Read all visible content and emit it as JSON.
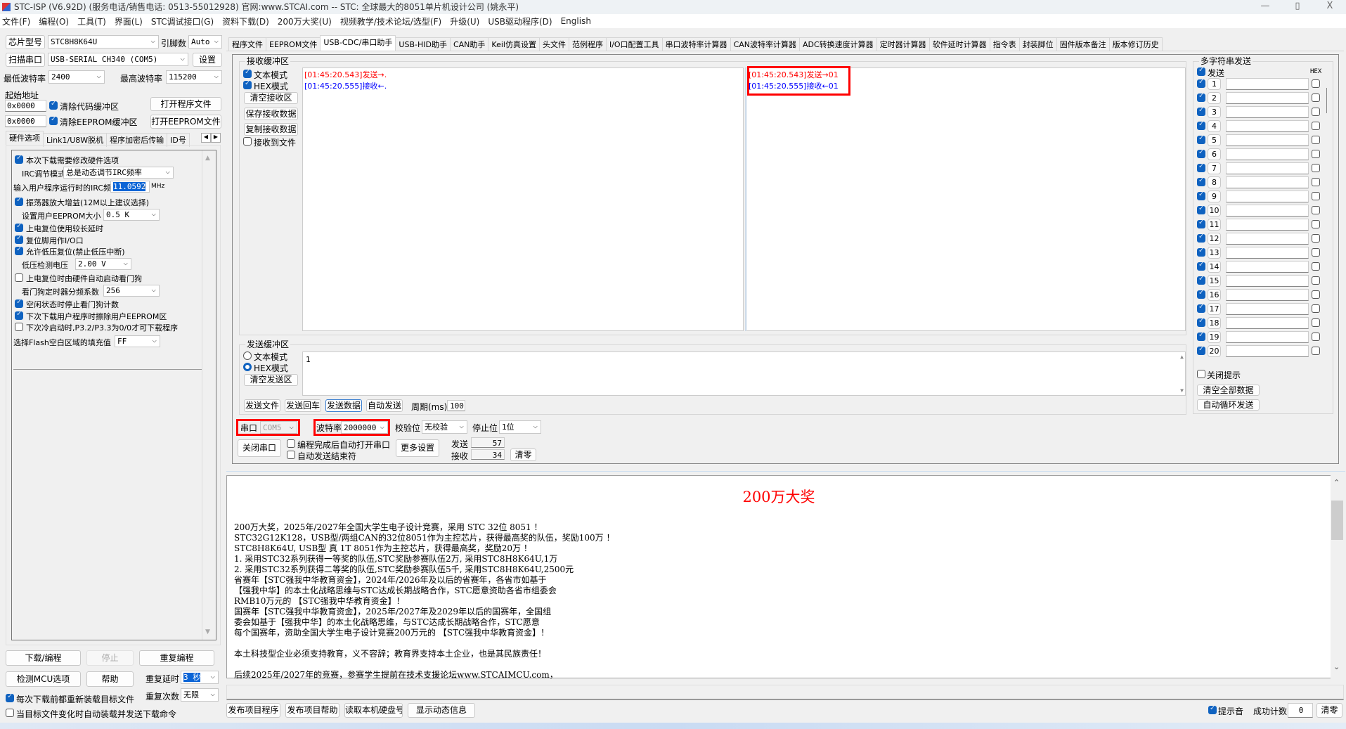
{
  "window": {
    "title": "STC-ISP (V6.92D) (服务电话/销售电话: 0513-55012928) 官网:www.STCAI.com  -- STC: 全球最大的8051单片机设计公司 (姚永平)",
    "minimize": "—",
    "maximize": "▯",
    "close": "X"
  },
  "menu": [
    "文件(F)",
    "编程(O)",
    "工具(T)",
    "界面(L)",
    "STC调试接口(G)",
    "资料下载(D)",
    "200万大奖(U)",
    "视频教学/技术论坛/选型(F)",
    "升级(U)",
    "USB驱动程序(D)",
    "English"
  ],
  "left": {
    "chip_label": "芯片型号",
    "chip_value": "STC8H8K64U",
    "pins_label": "引脚数",
    "pins_value": "Auto",
    "scan_label": "扫描串口",
    "port_value": "USB-SERIAL CH340 (COM5)",
    "settings_label": "设置",
    "min_baud_label": "最低波特率",
    "min_baud": "2400",
    "max_baud_label": "最高波特率",
    "max_baud": "115200",
    "start_addr_label": "起始地址",
    "code_addr": "0x0000",
    "clear_code": "清除代码缓冲区",
    "clear_code_checked": true,
    "eeprom_addr": "0x0000",
    "clear_eeprom": "清除EEPROM缓冲区",
    "clear_eeprom_checked": true,
    "open_prog": "打开程序文件",
    "open_eeprom": "打开EEPROM文件",
    "tabs": [
      "硬件选项",
      "Link1/U8W脱机",
      "程序加密后传输",
      "ID号"
    ],
    "options": [
      {
        "type": "check",
        "checked": true,
        "label": "本次下载需要修改硬件选项"
      },
      {
        "type": "select",
        "label": "IRC调节模式",
        "value": "总是动态调节IRC频率"
      },
      {
        "type": "select",
        "label": "输入用户程序运行时的IRC频率",
        "value": "11.0592",
        "unit": "MHz"
      },
      {
        "type": "check",
        "checked": true,
        "label": "振荡器放大增益(12M以上建议选择)"
      },
      {
        "type": "select",
        "label": "设置用户EEPROM大小",
        "value": "0.5 K"
      },
      {
        "type": "check",
        "checked": true,
        "label": "上电复位使用较长延时"
      },
      {
        "type": "check",
        "checked": true,
        "label": "复位脚用作I/O口"
      },
      {
        "type": "check",
        "checked": true,
        "label": "允许低压复位(禁止低压中断)"
      },
      {
        "type": "select",
        "label": "低压检测电压",
        "value": "2.00 V"
      },
      {
        "type": "check",
        "checked": false,
        "label": "上电复位时由硬件自动启动看门狗"
      },
      {
        "type": "select",
        "label": "看门狗定时器分频系数",
        "value": "256"
      },
      {
        "type": "check",
        "checked": true,
        "label": "空闲状态时停止看门狗计数"
      },
      {
        "type": "check",
        "checked": true,
        "label": "下次下载用户程序时擦除用户EEPROM区"
      },
      {
        "type": "check",
        "checked": false,
        "label": "下次冷启动时,P3.2/P3.3为0/0才可下载程序"
      },
      {
        "type": "select",
        "label": "选择Flash空白区域的填充值",
        "value": "FF"
      }
    ],
    "download": "下载/编程",
    "stop": "停止",
    "repeat_prog": "重复编程",
    "detect": "检测MCU选项",
    "help": "帮助",
    "repeat_delay_label": "重复延时",
    "repeat_delay": "3 秒",
    "repeat_count_label": "重复次数",
    "repeat_count": "无限",
    "reload_each": "每次下载前都重新装载目标文件",
    "reload_each_checked": true,
    "auto_reload": "当目标文件变化时自动装载并发送下载命令",
    "auto_reload_checked": false
  },
  "tabs": [
    "程序文件",
    "EEPROM文件",
    "USB-CDC/串口助手",
    "USB-HID助手",
    "CAN助手",
    "Keil仿真设置",
    "头文件",
    "范例程序",
    "I/O口配置工具",
    "串口波特率计算器",
    "CAN波特率计算器",
    "ADC转换速度计算器",
    "定时器计算器",
    "软件延时计算器",
    "指令表",
    "封装脚位",
    "固件版本备注",
    "版本修订历史"
  ],
  "active_tab": 2,
  "receive": {
    "title": "接收缓冲区",
    "text_mode": "文本模式",
    "text_mode_checked": true,
    "hex_mode": "HEX模式",
    "hex_mode_checked": true,
    "clear": "清空接收区",
    "save": "保存接收数据",
    "copy": "复制接收数据",
    "to_file": "接收到文件",
    "to_file_checked": false,
    "text_lines": [
      {
        "text": "[01:45:20.543]发送→.",
        "color": "#ff0000"
      },
      {
        "text": "[01:45:20.555]接收←.",
        "color": "#0000ff"
      }
    ],
    "hex_lines": [
      {
        "text": "[01:45:20.543]发送→01",
        "color": "#ff0000"
      },
      {
        "text": "[01:45:20.555]接收←01",
        "color": "#0000ff"
      }
    ]
  },
  "send": {
    "title": "发送缓冲区",
    "text_mode": "文本模式",
    "hex_mode": "HEX模式",
    "selected": "hex",
    "clear": "清空发送区",
    "content": "1",
    "send_file": "发送文件",
    "send_enter": "发送回车",
    "send_data": "发送数据",
    "auto_send": "自动发送",
    "period_label": "周期(ms)",
    "period": "100"
  },
  "serial": {
    "port_label": "串口",
    "port": "COM5",
    "baud_label": "波特率",
    "baud": "2000000",
    "parity_label": "校验位",
    "parity": "无校验",
    "stop_label": "停止位",
    "stop": "1位",
    "close_port": "关闭串口",
    "auto_open": "编程完成后自动打开串口",
    "auto_end": "自动发送结束符",
    "more": "更多设置",
    "sent_label": "发送",
    "sent": "57",
    "recv_label": "接收",
    "recv": "34",
    "clear": "清零"
  },
  "multi": {
    "title": "多字符串发送",
    "send_label": "发送",
    "hex_label": "HEX",
    "rows": [
      "1",
      "2",
      "3",
      "4",
      "5",
      "6",
      "7",
      "8",
      "9",
      "10",
      "11",
      "12",
      "13",
      "14",
      "15",
      "16",
      "17",
      "18",
      "19",
      "20"
    ],
    "close_tip": "关闭提示",
    "clear_all": "清空全部数据",
    "auto_loop": "自动循环发送"
  },
  "info": {
    "title": "200万大奖",
    "title_color": "#ff0000",
    "lines": [
      "200万大奖，2025年/2027年全国大学生电子设计竞赛，采用 STC 32位 8051 ！",
      "STC32G12K128，USB型/两组CAN的32位8051作为主控芯片，获得最高奖的队伍，奖励100万 ！",
      "STC8H8K64U, USB型 真 1T 8051作为主控芯片，获得最高奖，奖励20万 ！",
      "1. 采用STC32系列获得一等奖的队伍,STC奖励参赛队伍2万, 采用STC8H8K64U,1万",
      "2. 采用STC32系列获得二等奖的队伍,STC奖励参赛队伍5千, 采用STC8H8K64U,2500元",
      "省赛年【STC强我中华教育资金】，2024年/2026年及以后的省赛年，各省市如基于",
      "【强我中华】的本土化战略思维与STC达成长期战略合作，STC愿意资助各省市组委会",
      "RMB10万元的 【STC强我中华教育资金】！",
      "国赛年【STC强我中华教育资金】，2025年/2027年及2029年以后的国赛年，全国组",
      "委会如基于【强我中华】的本土化战略思维，与STC达成长期战略合作，STC愿意",
      "每个国赛年，资助全国大学生电子设计竞赛200万元的 【STC强我中华教育资金】！",
      "",
      "本土科技型企业必须支持教育，义不容辞；教育界支持本土企业，也是其民族责任！",
      "",
      "后续2025年/2027年的竞赛，参赛学生提前在技术支援论坛www.STCAIMCU.com，"
    ]
  },
  "bottom": {
    "publish_prog": "发布项目程序",
    "publish_help": "发布项目帮助",
    "read_disk": "读取本机硬盘号",
    "show_dynamic": "显示动态信息",
    "beep": "提示音",
    "beep_checked": true,
    "success_label": "成功计数",
    "success": "0",
    "clear": "清零"
  }
}
